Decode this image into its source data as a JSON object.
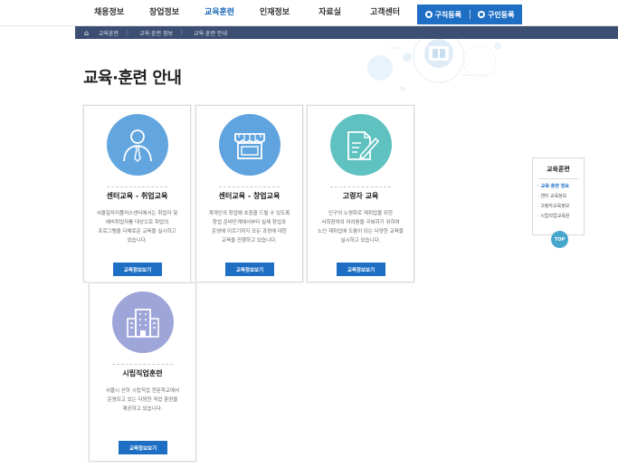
{
  "nav": {
    "items": [
      "채용정보",
      "창업정보",
      "교육훈련",
      "인재정보",
      "자료실",
      "고객센터"
    ],
    "active_index": 2,
    "btn_job_seek": "구직등록",
    "btn_job_offer": "구인등록"
  },
  "breadcrumb": [
    "교육훈련",
    "교육·훈련 정보",
    "교육·훈련 안내"
  ],
  "title": "교육·훈련 안내",
  "cards": [
    {
      "title": "센터교육 - 취업교육",
      "desc": "서울일자리플러스센터에서는 취업자 및 예비취업자를 대상으로 취업의 프로그램을 다채로운 교육을 실시하고 있습니다.",
      "button": "교육정보보기",
      "icon": "person-tie-icon",
      "color": "#63a6df"
    },
    {
      "title": "센터교육 - 창업교육",
      "desc": "계개인의 창업에 초중을 드릴 수 있도록 창업 준비단계에서부터 실제 창업과 운영에 이르기까지 모든 과정에 대한 교육을 진행하고 있습니다.",
      "button": "교육정보보기",
      "icon": "storefront-icon",
      "color": "#5fa3df"
    },
    {
      "title": "고령자 교육",
      "desc": "인구의 노령화로 재취업을 위한 사회참여의 어려움을 극복하기 위하여 노인 재취업에 도움이 되는 다양한 교육을 실시하고 있습니다.",
      "button": "교육정보보기",
      "icon": "document-pen-icon",
      "color": "#5fc2c0"
    },
    {
      "title": "시립직업훈련",
      "desc": "서울시 산하 시립직업 전문학교에서 운영되고 있는 다양한 직업 훈련을 제공하고 있습니다.",
      "button": "교육정보보기",
      "icon": "building-icon",
      "color": "#9ea6d9"
    }
  ],
  "side": {
    "title": "교육훈련",
    "items": [
      "교육·훈련 정보",
      "센터 교육정보",
      "고령자교육정보",
      "시립직업교육원"
    ],
    "active_index": 0,
    "top": "TOP"
  }
}
